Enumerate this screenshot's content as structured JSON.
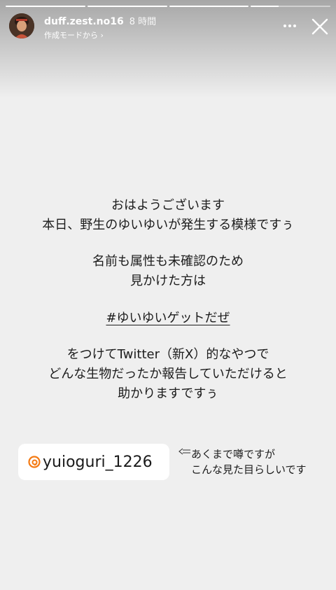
{
  "story": {
    "progress": [
      1,
      1,
      1,
      0.35
    ],
    "header": {
      "username": "duff.zest.no16",
      "time_ago": "8 時間",
      "source": "作成モードから ›",
      "avatar_icon": "profile-avatar",
      "more_icon": "more-horizontal-icon",
      "close_icon": "close-icon"
    },
    "text": {
      "line1": "おはようございます",
      "line2": "本日、野生のゆいゆいが発生する模様ですぅ",
      "line3": "名前も属性も未確認のため",
      "line4": "見かけた方は",
      "hashtag": "#ゆいゆいゲットだぜ",
      "line5": "をつけてTwitter（新X）的なやつで",
      "line6": "どんな生物だったか報告していただけると",
      "line7": "助かりますですぅ"
    },
    "mention": {
      "icon": "threads-icon",
      "handle": "yuioguri_1226",
      "accent_color": "#f47a13"
    },
    "note": {
      "arrow": "⇐",
      "line1": "あくまで噂ですが",
      "line2": "こんな見た目らしいです"
    }
  }
}
